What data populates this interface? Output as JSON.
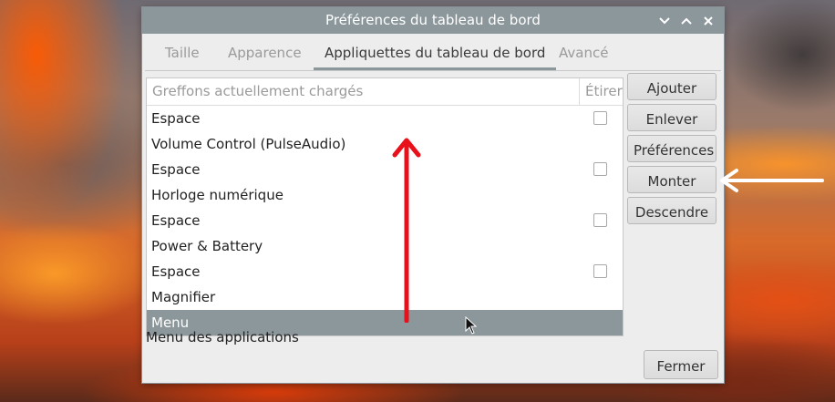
{
  "window": {
    "title": "Préférences du tableau de bord"
  },
  "tabs": [
    {
      "label": "Taille",
      "active": false
    },
    {
      "label": "Apparence",
      "active": false
    },
    {
      "label": "Appliquettes du tableau de bord",
      "active": true
    },
    {
      "label": "Avancé",
      "active": false
    }
  ],
  "list": {
    "header": "Greffons actuellement chargés",
    "stretch_header": "Étirer",
    "items": [
      {
        "label": "Espace",
        "has_checkbox": true,
        "checked": false
      },
      {
        "label": "Volume Control (PulseAudio)",
        "has_checkbox": false
      },
      {
        "label": "Espace",
        "has_checkbox": true,
        "checked": false
      },
      {
        "label": "Horloge numérique",
        "has_checkbox": false
      },
      {
        "label": "Espace",
        "has_checkbox": true,
        "checked": false
      },
      {
        "label": "Power & Battery",
        "has_checkbox": false
      },
      {
        "label": "Espace",
        "has_checkbox": true,
        "checked": false
      },
      {
        "label": "Magnifier",
        "has_checkbox": false
      },
      {
        "label": "Menu",
        "has_checkbox": false,
        "selected": true
      }
    ],
    "description": "Menu des applications"
  },
  "buttons": {
    "add": "Ajouter",
    "remove": "Enlever",
    "preferences": "Préférences",
    "up": "Monter",
    "down": "Descendre",
    "close": "Fermer"
  },
  "icons": {
    "minimize": "chevron-down-icon",
    "maximize": "chevron-up-icon",
    "close": "close-icon"
  },
  "colors": {
    "titlebar": "#8c979c",
    "selected_row": "#8c979c",
    "annotation_arrow_red": "#e8101a",
    "annotation_arrow_white": "#ffffff"
  }
}
